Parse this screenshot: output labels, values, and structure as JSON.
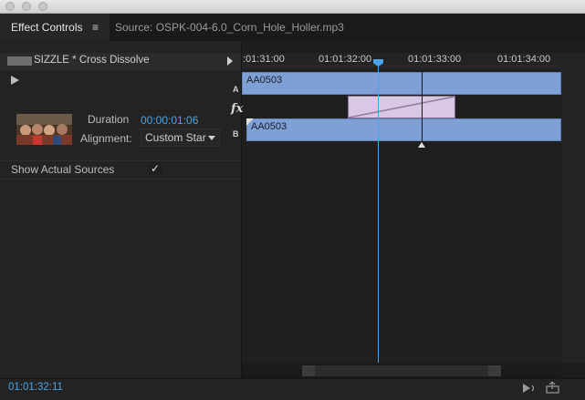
{
  "window": {
    "title": ""
  },
  "tabs": [
    {
      "label": "Effect Controls",
      "active": true,
      "menu_icon": "hamburger-menu-icon",
      "menu_glyph": "≡"
    },
    {
      "label": "Source: OSPK-004-6.0_Corn_Hole_Holler.mp3",
      "active": false
    }
  ],
  "effect": {
    "clip_title": "SIZZLE * Cross Dissolve",
    "duration_label": "Duration",
    "duration_value": "00:00:01:06",
    "alignment_label": "Alignment:",
    "alignment_value": "Custom Star",
    "show_sources_label": "Show Actual Sources",
    "show_sources_checked": true,
    "check_glyph": "✓"
  },
  "timeline": {
    "ruler_labels": [
      ":01:31:00",
      "01:01:32:00",
      "01:01:33:00",
      "01:01:34:00"
    ],
    "track_a_letter": "A",
    "track_b_letter": "B",
    "fx_glyph": "fx",
    "clip_a_label": "AA0503",
    "clip_b_label": "AA0503",
    "playhead_color": "#4aa3e8",
    "clip_color": "#7ea0d4",
    "transition_color": "#d8c8e4"
  },
  "footer": {
    "timecode": "01:01:32:11",
    "icons": [
      "play-audio-icon",
      "export-icon"
    ]
  }
}
